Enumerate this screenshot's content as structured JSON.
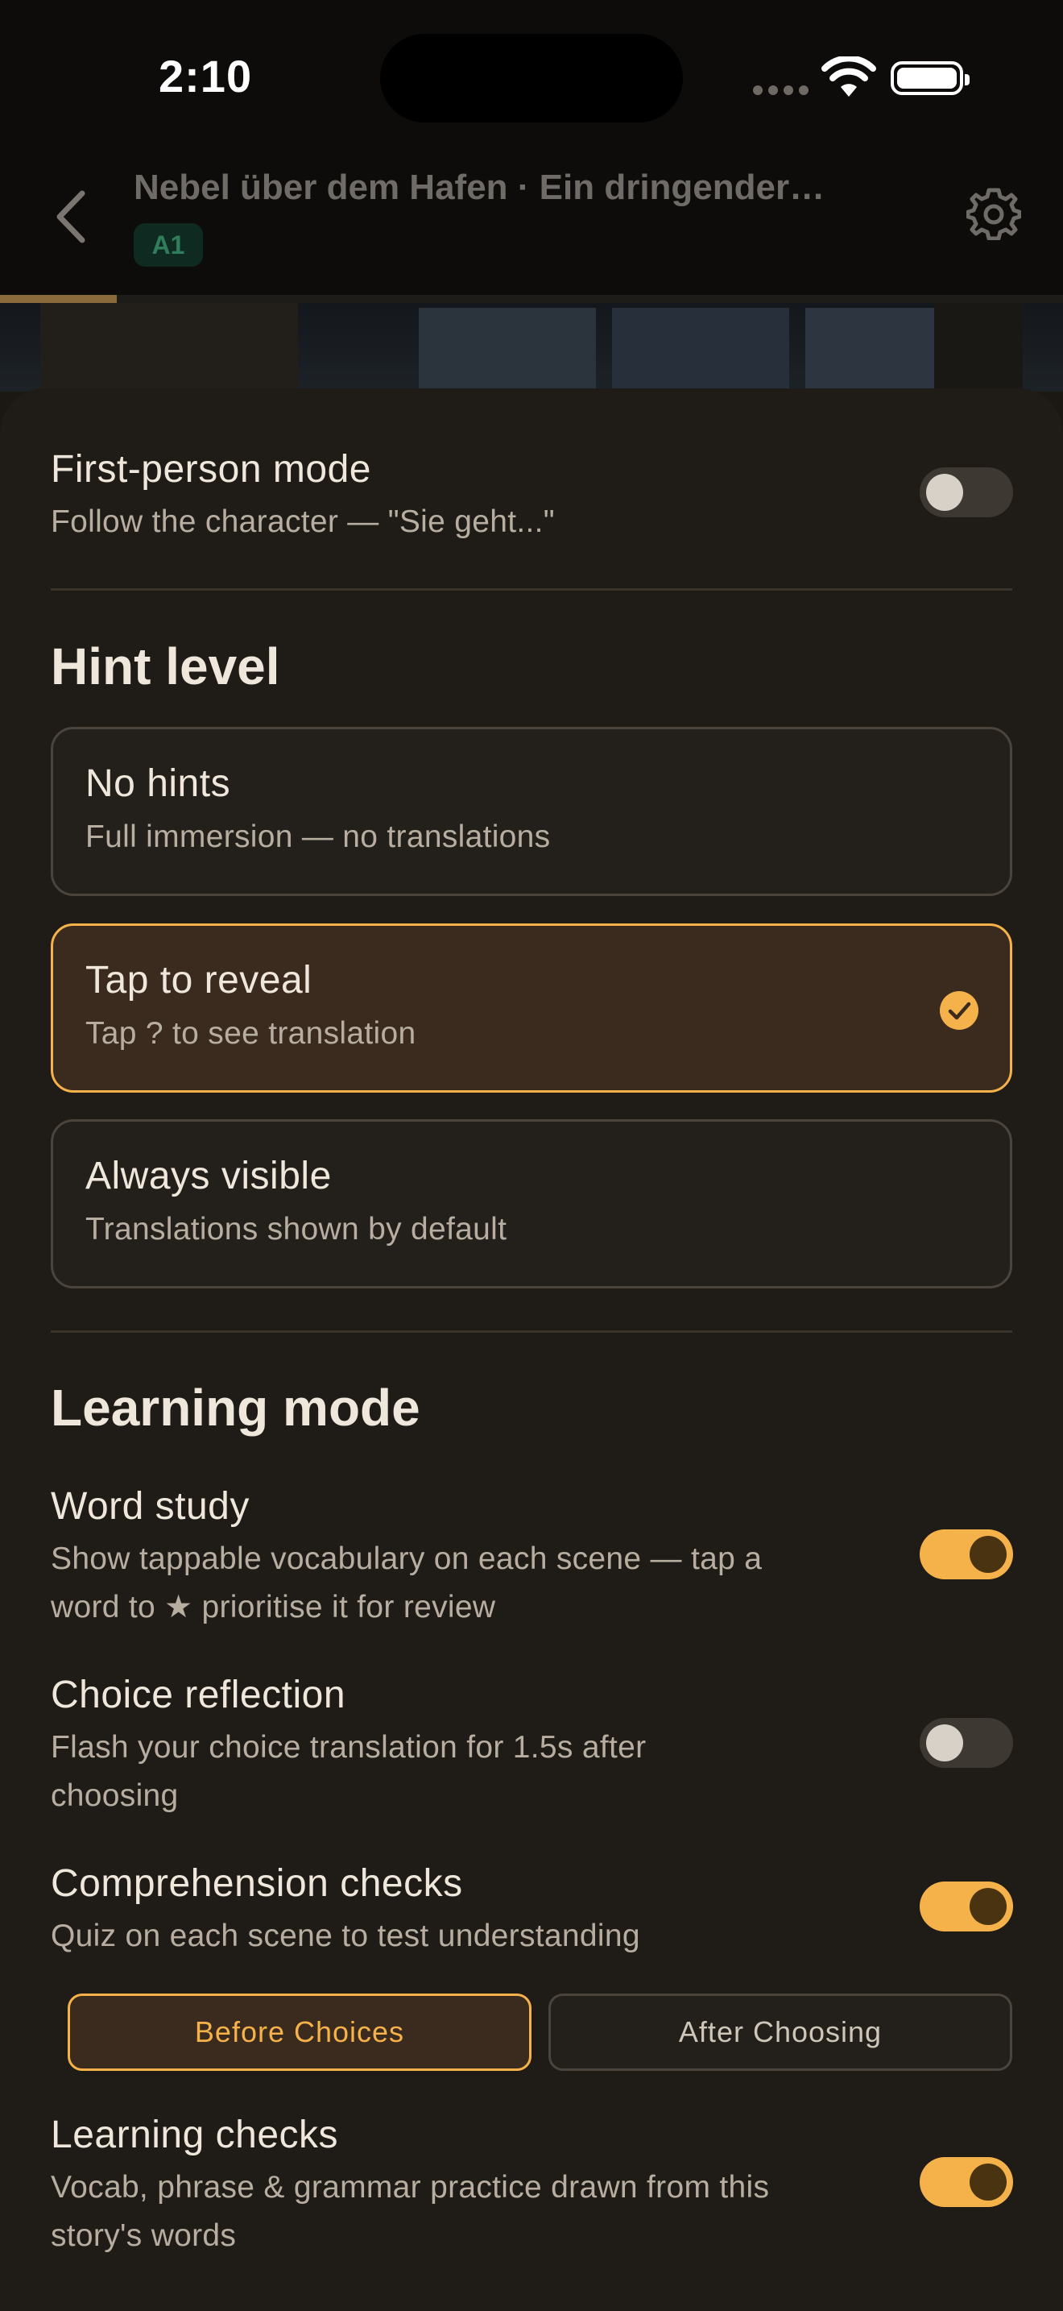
{
  "status_bar": {
    "time": "2:10"
  },
  "header": {
    "title": "Nebel über dem Hafen · Ein dringender…",
    "level": "A1",
    "progress_fraction": 0.11
  },
  "first_person": {
    "title": "First-person mode",
    "subtitle": "Follow the character — \"Sie geht...\"",
    "enabled": false
  },
  "hint_level": {
    "heading": "Hint level",
    "options": [
      {
        "title": "No hints",
        "subtitle": "Full immersion — no translations",
        "selected": false
      },
      {
        "title": "Tap to reveal",
        "subtitle": "Tap ? to see translation",
        "selected": true
      },
      {
        "title": "Always visible",
        "subtitle": "Translations shown by default",
        "selected": false
      }
    ]
  },
  "learning_mode": {
    "heading": "Learning mode",
    "word_study": {
      "title": "Word study",
      "subtitle_line1": "Show tappable vocabulary on each scene — tap a",
      "subtitle_line2": "word to ★ prioritise it for review",
      "enabled": true
    },
    "choice_reflection": {
      "title": "Choice reflection",
      "subtitle_line1": "Flash your choice translation for 1.5s after",
      "subtitle_line2": "choosing",
      "enabled": false
    },
    "comprehension_checks": {
      "title": "Comprehension checks",
      "subtitle": "Quiz on each scene to test understanding",
      "enabled": true,
      "timing_options": [
        "Before Choices",
        "After Choosing"
      ],
      "selected_timing": "Before Choices"
    },
    "learning_checks": {
      "title": "Learning checks",
      "subtitle_line1": "Vocab, phrase & grammar practice drawn from this",
      "subtitle_line2": "story's words",
      "enabled": true
    }
  },
  "colors": {
    "accent": "#f6b24a",
    "background": "#1f1b16",
    "level_badge": "#2f7d5a"
  }
}
